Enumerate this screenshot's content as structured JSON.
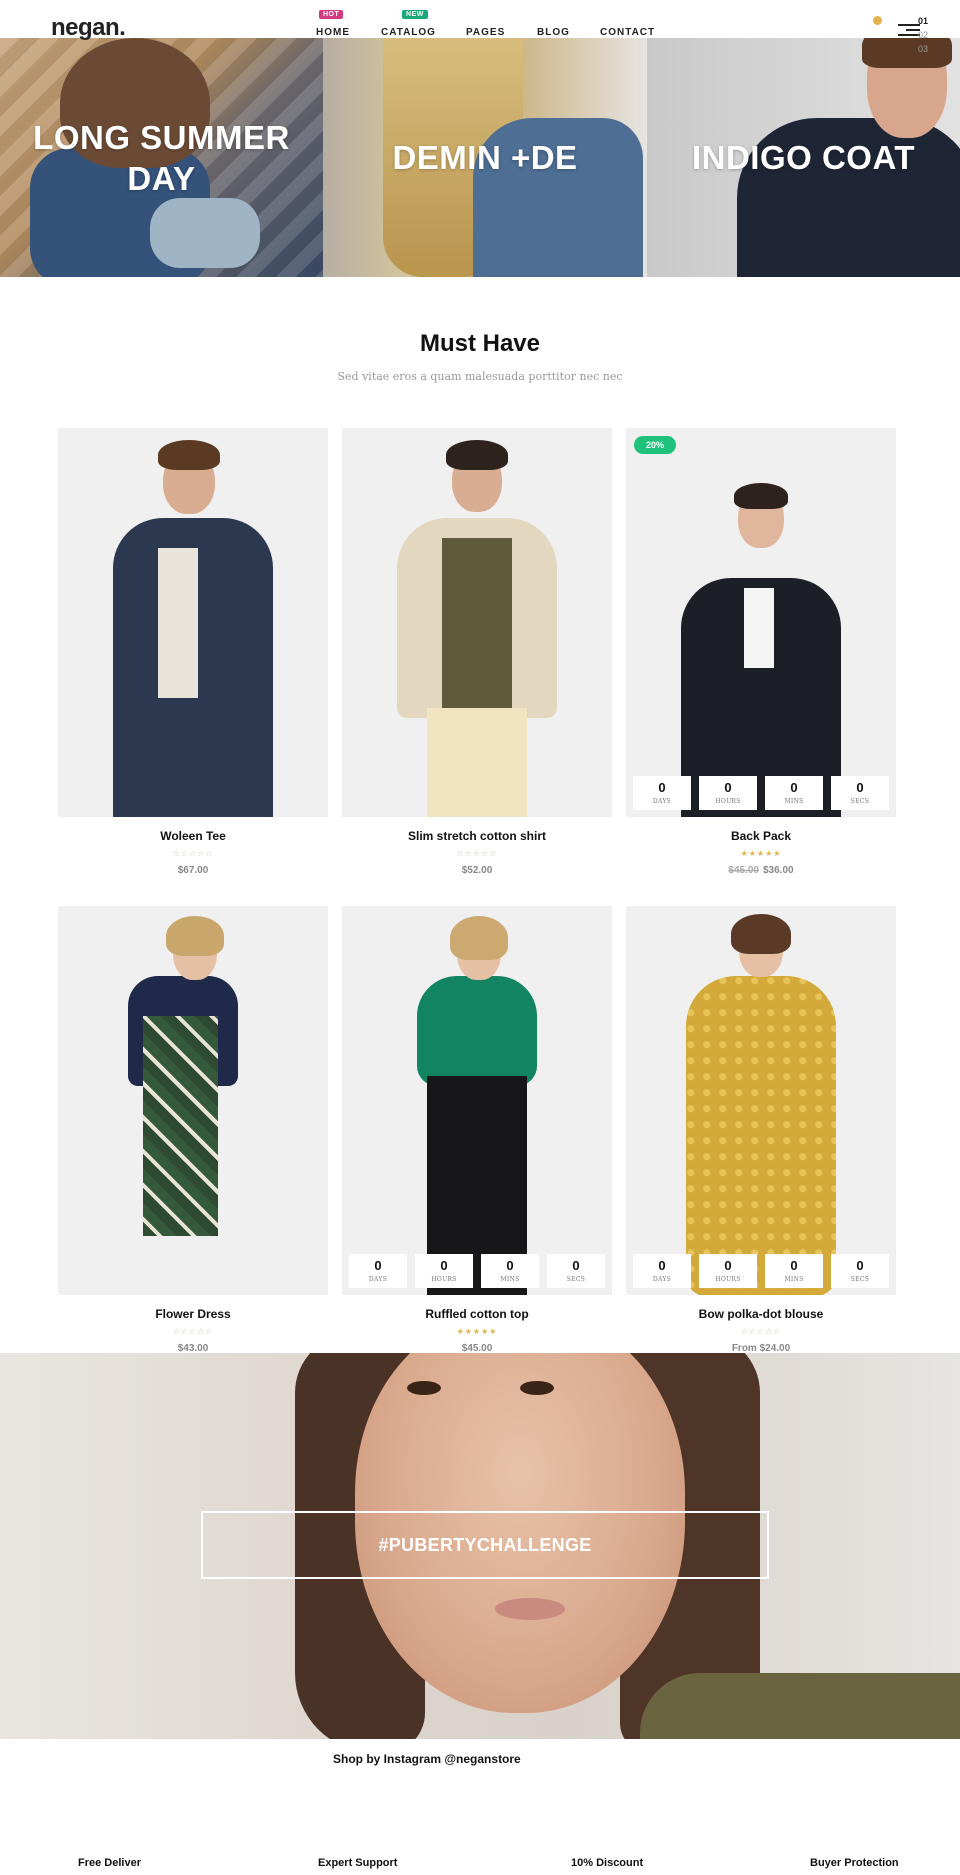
{
  "header": {
    "logo": "negan.",
    "nav": [
      {
        "label": "HOME",
        "badge": "HOT"
      },
      {
        "label": "CATALOG",
        "badge": "NEW"
      },
      {
        "label": "PAGES",
        "badge": ""
      },
      {
        "label": "BLOG",
        "badge": ""
      },
      {
        "label": "CONTACT",
        "badge": ""
      }
    ],
    "cart_count": "0",
    "slide_index": [
      "01",
      "02",
      "03"
    ]
  },
  "hero": {
    "panels": [
      {
        "title_line1": "LONG SUMMER",
        "title_line2": "DAY"
      },
      {
        "title_line1": "DEMIN +DE",
        "title_line2": ""
      },
      {
        "title_line1": "INDIGO COAT",
        "title_line2": ""
      }
    ]
  },
  "must_have": {
    "title": "Must Have",
    "subtitle": "Sed vitae eros a quam malesuada porttitor nec nec"
  },
  "countdown_units": {
    "days": "DAYS",
    "hours": "HOURS",
    "mins": "MINS",
    "secs": "SECS"
  },
  "products": [
    {
      "name": "Woleen Tee",
      "price": "$67.00",
      "old_price": "",
      "rating": 0,
      "stars": "☆☆☆☆☆"
    },
    {
      "name": "Slim stretch cotton shirt",
      "price": "$52.00",
      "old_price": "",
      "rating": 0,
      "stars": "☆☆☆☆☆"
    },
    {
      "name": "Back Pack",
      "price": "$36.00",
      "old_price": "$45.00",
      "rating": 5,
      "stars": "★★★★★",
      "badge": "20%",
      "countdown": {
        "days": "0",
        "hours": "0",
        "mins": "0",
        "secs": "0"
      }
    },
    {
      "name": "Flower Dress",
      "price": "$43.00",
      "old_price": "",
      "rating": 0,
      "stars": "☆☆☆☆☆"
    },
    {
      "name": "Ruffled cotton top",
      "price": "$45.00",
      "old_price": "",
      "rating": 5,
      "stars": "★★★★★",
      "countdown": {
        "days": "0",
        "hours": "0",
        "mins": "0",
        "secs": "0"
      }
    },
    {
      "name": "Bow polka-dot blouse",
      "price": "From $24.00",
      "old_price": "",
      "rating": 0,
      "stars": "☆☆☆☆☆",
      "countdown": {
        "days": "0",
        "hours": "0",
        "mins": "0",
        "secs": "0"
      }
    }
  ],
  "instagram": {
    "hashtag": "#PUBERTYCHALLENGE",
    "caption": "Shop by Instagram @neganstore"
  },
  "features": [
    "Free Deliver",
    "Expert Support",
    "10% Discount",
    "Buyer Protection"
  ],
  "colors": {
    "accent_gold": "#e3b24c",
    "sale_green": "#1ec27a",
    "hot_badge": "#d23b7f",
    "new_badge": "#18a97a"
  }
}
